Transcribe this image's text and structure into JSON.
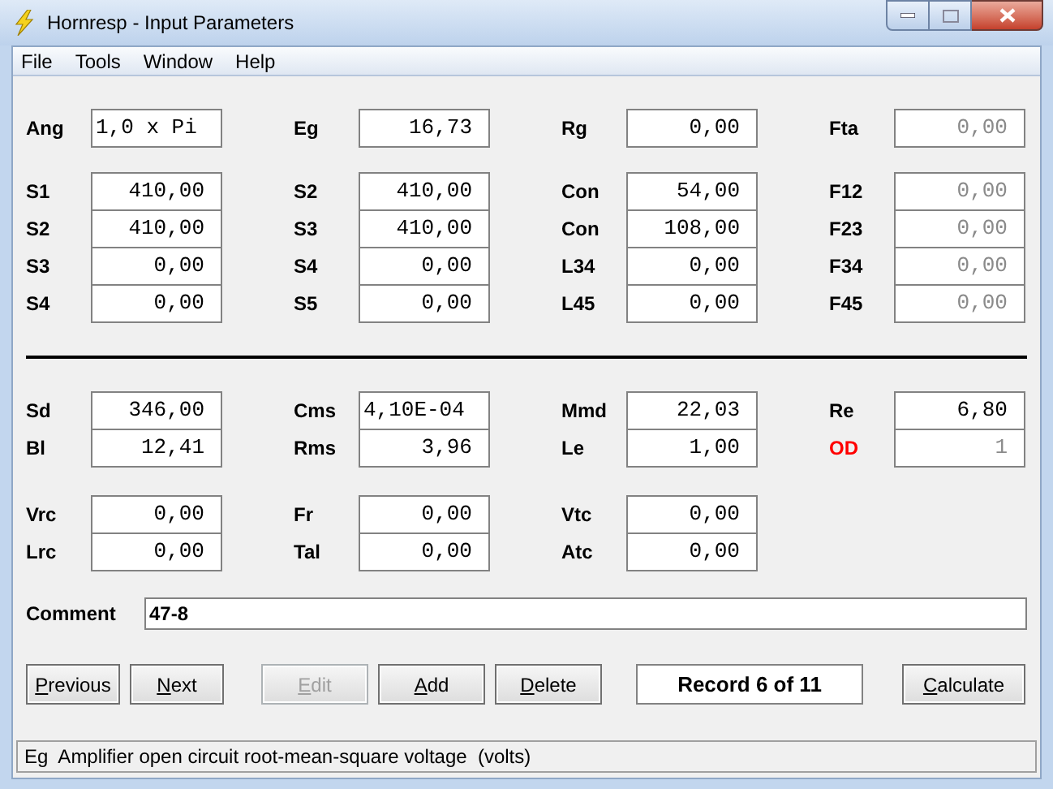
{
  "window": {
    "title": "Hornresp - Input Parameters"
  },
  "menu": [
    "File",
    "Tools",
    "Window",
    "Help"
  ],
  "blocks": [
    {
      "rows": [
        [
          {
            "label": "Ang",
            "value": "1,0 x Pi",
            "kind": "text",
            "disabled": false,
            "flagged": false
          },
          {
            "label": "Eg",
            "value": "16,73",
            "kind": "number",
            "disabled": false,
            "flagged": false
          },
          {
            "label": "Rg",
            "value": "0,00",
            "kind": "number",
            "disabled": false,
            "flagged": false
          },
          {
            "label": "Fta",
            "value": "0,00",
            "kind": "number",
            "disabled": true,
            "flagged": false
          }
        ]
      ]
    },
    {
      "rows": [
        [
          {
            "label": "S1",
            "value": "410,00",
            "kind": "number",
            "disabled": false,
            "flagged": false
          },
          {
            "label": "S2",
            "value": "410,00",
            "kind": "number",
            "disabled": false,
            "flagged": false
          },
          {
            "label": "Con",
            "value": "54,00",
            "kind": "number",
            "disabled": false,
            "flagged": false
          },
          {
            "label": "F12",
            "value": "0,00",
            "kind": "number",
            "disabled": true,
            "flagged": false
          }
        ],
        [
          {
            "label": "S2",
            "value": "410,00",
            "kind": "number",
            "disabled": false,
            "flagged": false
          },
          {
            "label": "S3",
            "value": "410,00",
            "kind": "number",
            "disabled": false,
            "flagged": false
          },
          {
            "label": "Con",
            "value": "108,00",
            "kind": "number",
            "disabled": false,
            "flagged": false
          },
          {
            "label": "F23",
            "value": "0,00",
            "kind": "number",
            "disabled": true,
            "flagged": false
          }
        ],
        [
          {
            "label": "S3",
            "value": "0,00",
            "kind": "number",
            "disabled": false,
            "flagged": false
          },
          {
            "label": "S4",
            "value": "0,00",
            "kind": "number",
            "disabled": false,
            "flagged": false
          },
          {
            "label": "L34",
            "value": "0,00",
            "kind": "number",
            "disabled": false,
            "flagged": false
          },
          {
            "label": "F34",
            "value": "0,00",
            "kind": "number",
            "disabled": true,
            "flagged": false
          }
        ],
        [
          {
            "label": "S4",
            "value": "0,00",
            "kind": "number",
            "disabled": false,
            "flagged": false
          },
          {
            "label": "S5",
            "value": "0,00",
            "kind": "number",
            "disabled": false,
            "flagged": false
          },
          {
            "label": "L45",
            "value": "0,00",
            "kind": "number",
            "disabled": false,
            "flagged": false
          },
          {
            "label": "F45",
            "value": "0,00",
            "kind": "number",
            "disabled": true,
            "flagged": false
          }
        ]
      ],
      "divider_after": true
    },
    {
      "rows": [
        [
          {
            "label": "Sd",
            "value": "346,00",
            "kind": "number",
            "disabled": false,
            "flagged": false
          },
          {
            "label": "Cms",
            "value": "4,10E-04",
            "kind": "text",
            "disabled": false,
            "flagged": false
          },
          {
            "label": "Mmd",
            "value": "22,03",
            "kind": "number",
            "disabled": false,
            "flagged": false
          },
          {
            "label": "Re",
            "value": "6,80",
            "kind": "number",
            "disabled": false,
            "flagged": false
          }
        ],
        [
          {
            "label": "Bl",
            "value": "12,41",
            "kind": "number",
            "disabled": false,
            "flagged": false
          },
          {
            "label": "Rms",
            "value": "3,96",
            "kind": "number",
            "disabled": false,
            "flagged": false
          },
          {
            "label": "Le",
            "value": "1,00",
            "kind": "number",
            "disabled": false,
            "flagged": false
          },
          {
            "label": "OD",
            "value": "1",
            "kind": "number",
            "disabled": true,
            "flagged": true
          }
        ]
      ]
    },
    {
      "rows": [
        [
          {
            "label": "Vrc",
            "value": "0,00",
            "kind": "number",
            "disabled": false,
            "flagged": false
          },
          {
            "label": "Fr",
            "value": "0,00",
            "kind": "number",
            "disabled": false,
            "flagged": false
          },
          {
            "label": "Vtc",
            "value": "0,00",
            "kind": "number",
            "disabled": false,
            "flagged": false
          }
        ],
        [
          {
            "label": "Lrc",
            "value": "0,00",
            "kind": "number",
            "disabled": false,
            "flagged": false
          },
          {
            "label": "Tal",
            "value": "0,00",
            "kind": "number",
            "disabled": false,
            "flagged": false
          },
          {
            "label": "Atc",
            "value": "0,00",
            "kind": "number",
            "disabled": false,
            "flagged": false
          }
        ]
      ]
    }
  ],
  "comment": {
    "label": "Comment",
    "value": "47-8"
  },
  "buttons": [
    {
      "label": "Previous",
      "disabled": false
    },
    {
      "label": "Next",
      "disabled": false
    },
    {
      "label": "Edit",
      "disabled": true
    },
    {
      "label": "Add",
      "disabled": false
    },
    {
      "label": "Delete",
      "disabled": false
    }
  ],
  "record": "Record 6 of 11",
  "calculate": {
    "label": "Calculate",
    "disabled": false
  },
  "status_bar": "Eg  Amplifier open circuit root-mean-square voltage  (volts)"
}
